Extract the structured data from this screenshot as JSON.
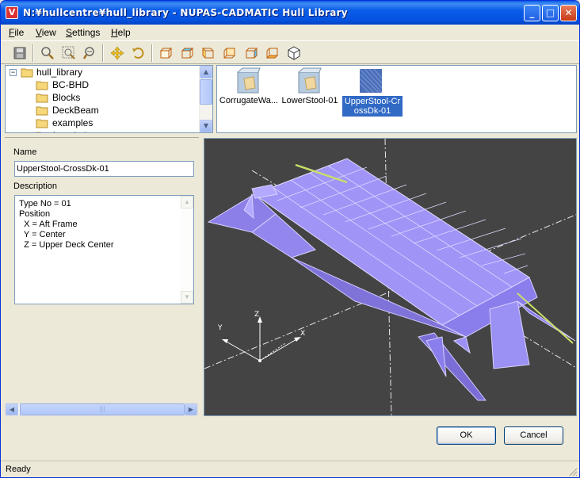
{
  "window": {
    "title": "N:¥hullcentre¥hull_library - NUPAS-CADMATIC Hull Library",
    "app_icon": "nupas-app-icon",
    "controls": {
      "minimize": "_",
      "maximize": "□",
      "close": "✕"
    }
  },
  "menu": {
    "file": "File",
    "view": "View",
    "settings": "Settings",
    "help": "Help"
  },
  "toolbar": {
    "buttons": [
      "save-icon",
      "zoom-in-icon",
      "zoom-window-icon",
      "zoom-out-icon",
      "pan-icon",
      "rotate-icon",
      "view-front-icon",
      "view-top-icon",
      "view-side-icon",
      "view-back-icon",
      "view-right-icon",
      "view-bottom-icon",
      "view-iso-icon"
    ]
  },
  "tree": {
    "expander": "−",
    "root": "hull_library",
    "items": [
      "BC-BHD",
      "Blocks",
      "DeckBeam",
      "examples",
      "foundations"
    ]
  },
  "files": {
    "items": [
      {
        "label": "CorrugateWa...",
        "selected": false
      },
      {
        "label": "LowerStool-01",
        "selected": false
      },
      {
        "label_line1": "UpperStool-Cr",
        "label_line2": "ossDk-01",
        "selected": true
      }
    ]
  },
  "properties": {
    "name_label": "Name",
    "name_value": "UpperStool-CrossDk-01",
    "description_label": "Description",
    "description_lines": [
      "Type No = 01",
      "Position",
      "  X = Aft Frame",
      "  Y = Center",
      "  Z = Upper Deck Center"
    ]
  },
  "viewport": {
    "axis_x": "X",
    "axis_y": "Y",
    "axis_z": "Z",
    "background": "#444444",
    "model_color": "#9a8cf5",
    "edge_color": "#d8d2ff",
    "highlight_color": "#c8e06a"
  },
  "buttons": {
    "ok": "OK",
    "cancel": "Cancel"
  },
  "status": {
    "text": "Ready"
  }
}
